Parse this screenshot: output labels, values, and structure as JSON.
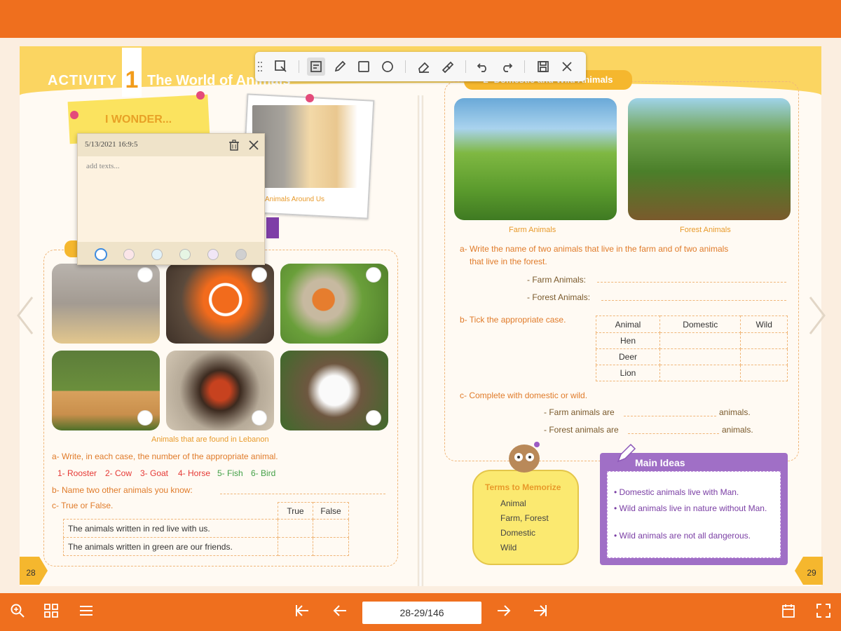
{
  "toolbar": {
    "icons": [
      "select-icon",
      "note-icon",
      "pen-icon",
      "rectangle-icon",
      "circle-icon",
      "eraser-icon",
      "clear-icon",
      "undo-icon",
      "redo-icon",
      "save-icon",
      "close-icon"
    ]
  },
  "activity": {
    "label": "ACTIVITY",
    "number": "1",
    "title": "The World of Animals"
  },
  "wonder": {
    "text": "I WONDER..."
  },
  "photo": {
    "caption": "Animals Around Us"
  },
  "note": {
    "timestamp": "5/13/2021 16:9:5",
    "placeholder": "add texts..."
  },
  "left": {
    "caption": "Animals that are found in Lebanon",
    "qa": "a- Write, in each case, the number of the appropriate animal.",
    "items": [
      "1- Rooster",
      "2- Cow",
      "3- Goat",
      "4- Horse",
      "5- Fish",
      "6- Bird"
    ],
    "qb": "b- Name two other animals you know:",
    "qc": "c- True or False.",
    "tf_true": "True",
    "tf_false": "False",
    "tf_rows": [
      "The animals written in red live with us.",
      "The animals written in green are our friends."
    ],
    "page": "28"
  },
  "right": {
    "section": "2- Domestic and Wild Animals",
    "farm": "Farm Animals",
    "forest": "Forest Animals",
    "qa": "a- Write the name of two animals that live in the farm and of two animals",
    "qa2": "that live in the forest.",
    "farm_line": "- Farm Animals:",
    "forest_line": "- Forest Animals:",
    "qb": "b- Tick the appropriate case.",
    "tbl_head": [
      "Animal",
      "Domestic",
      "Wild"
    ],
    "tbl_rows": [
      "Hen",
      "Deer",
      "Lion"
    ],
    "qc": "c- Complete with domestic or wild.",
    "c1": "- Farm animals are",
    "c2": "- Forest animals are",
    "c_end": "animals.",
    "page": "29"
  },
  "terms": {
    "title": "Terms to Memorize",
    "items": [
      "Animal",
      "Farm, Forest",
      "Domestic",
      "Wild"
    ]
  },
  "main_ideas": {
    "title": "Main Ideas",
    "items": [
      "Domestic animals live with Man.",
      "Wild animals live in nature without Man.",
      "Wild animals are not all dangerous."
    ]
  },
  "nav": {
    "page": "28-29/146"
  }
}
